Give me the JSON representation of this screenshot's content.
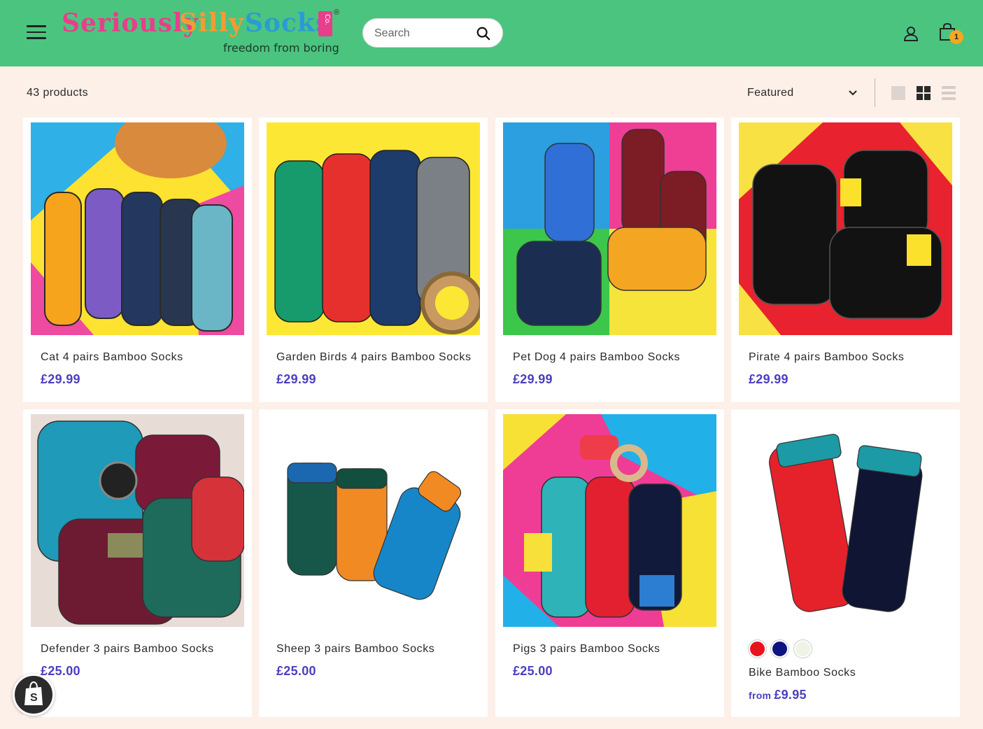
{
  "header": {
    "logo": {
      "word1": "Seriously",
      "word2": "Silly",
      "word3": "Socks",
      "mark": "Co.",
      "reg": "®",
      "tagline": "freedom from boring"
    },
    "search_placeholder": "Search",
    "cart_count": "1"
  },
  "toolbar": {
    "product_count": "43 products",
    "sort_label": "Featured"
  },
  "colors": {
    "header_bg": "#4bc47f",
    "page_bg": "#fdf0e8",
    "price": "#4a3fc0",
    "cart_badge": "#f5a623"
  },
  "products": [
    {
      "title": "Cat 4 pairs Bamboo Socks",
      "price": "£29.99"
    },
    {
      "title": "Garden Birds 4 pairs Bamboo Socks",
      "price": "£29.99"
    },
    {
      "title": "Pet Dog 4 pairs Bamboo Socks",
      "price": "£29.99"
    },
    {
      "title": "Pirate 4 pairs Bamboo Socks",
      "price": "£29.99"
    },
    {
      "title": "Defender 3 pairs Bamboo Socks",
      "price": "£25.00"
    },
    {
      "title": "Sheep 3 pairs Bamboo Socks",
      "price": "£25.00"
    },
    {
      "title": "Pigs 3 pairs Bamboo Socks",
      "price": "£25.00"
    },
    {
      "title": "Bike Bamboo Socks",
      "price_prefix": "from",
      "price": "£9.95",
      "swatches": [
        "#e8141c",
        "#0d1480",
        "#eef3e6"
      ]
    }
  ]
}
